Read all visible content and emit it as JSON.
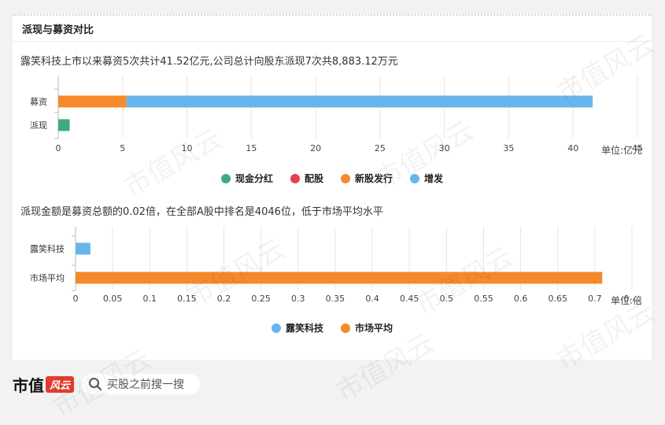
{
  "section_title": "派现与募资对比",
  "footer": {
    "logo_text": "市值",
    "logo_badge": "风云",
    "search_placeholder": "买股之前搜一搜"
  },
  "colors": {
    "cash_dividend": "#3dab7a",
    "rights_issue": "#e8414a",
    "ipo": "#f6892b",
    "placement": "#68b5ec"
  },
  "chart_data": [
    {
      "type": "bar",
      "orientation": "horizontal",
      "stacked": true,
      "summary": "露笑科技上市以来募资5次共计41.52亿元,公司总计向股东派现7次共8,883.12万元",
      "categories": [
        "募资",
        "派现"
      ],
      "series": [
        {
          "name": "现金分红",
          "color": "#3dab7a",
          "values": [
            0,
            0.89
          ]
        },
        {
          "name": "配股",
          "color": "#e8414a",
          "values": [
            0,
            0
          ]
        },
        {
          "name": "新股发行",
          "color": "#f6892b",
          "values": [
            5.3,
            0
          ]
        },
        {
          "name": "增发",
          "color": "#68b5ec",
          "values": [
            36.22,
            0
          ]
        }
      ],
      "xlim": [
        0,
        45
      ],
      "xticks": [
        "0",
        "5",
        "10",
        "15",
        "20",
        "25",
        "30",
        "35",
        "40",
        "45"
      ],
      "unit": "单位:亿元",
      "grid": true,
      "legend": "bottom"
    },
    {
      "type": "bar",
      "orientation": "horizontal",
      "summary": "派现金额是募资总额的0.02倍，在全部A股中排名是4046位，低于市场平均水平",
      "categories": [
        "露笑科技",
        "市场平均"
      ],
      "series": [
        {
          "name": "露笑科技",
          "color": "#68b5ec",
          "values": [
            0.02,
            0
          ]
        },
        {
          "name": "市场平均",
          "color": "#f6892b",
          "values": [
            0,
            0.71
          ]
        }
      ],
      "xlim": [
        0,
        0.75
      ],
      "xticks": [
        "0",
        "0.05",
        "0.1",
        "0.15",
        "0.2",
        "0.25",
        "0.3",
        "0.35",
        "0.4",
        "0.45",
        "0.5",
        "0.55",
        "0.6",
        "0.65",
        "0.7",
        "0...."
      ],
      "unit": "单位:倍",
      "grid": true,
      "legend": "bottom"
    }
  ]
}
